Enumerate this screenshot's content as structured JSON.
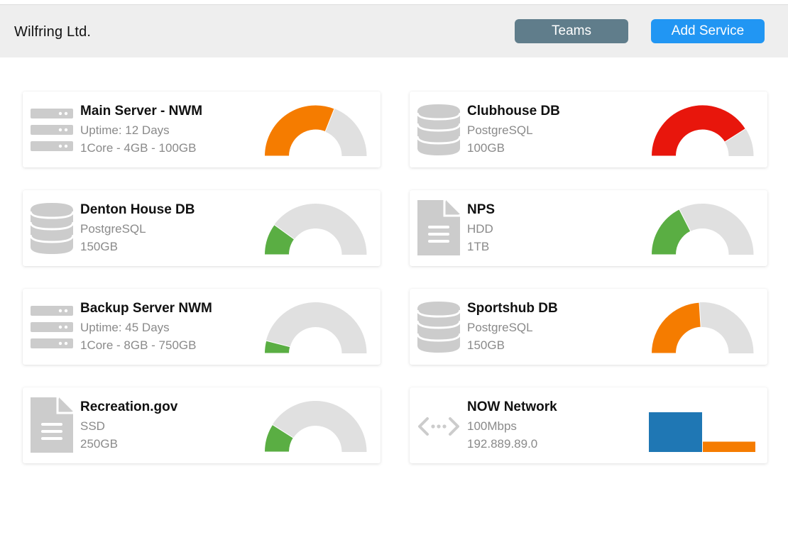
{
  "header": {
    "company": "Wilfring Ltd.",
    "teams_label": "Teams",
    "add_service_label": "Add Service"
  },
  "colors": {
    "orange": "#f57c00",
    "red": "#e8160c",
    "green": "#5aae43",
    "gray": "#e0e0e0",
    "blue": "#1f77b4",
    "icon": "#cccccc"
  },
  "cards": [
    {
      "name": "Main Server - NWM",
      "line1": "Uptime: 12 Days",
      "line2": "1Core - 4GB - 100GB",
      "icon": "server-icon",
      "gauge": 0.62,
      "color": "orange"
    },
    {
      "name": "Clubhouse DB",
      "line1": "PostgreSQL",
      "line2": "100GB",
      "icon": "database-icon",
      "gauge": 0.82,
      "color": "red"
    },
    {
      "name": "Denton House DB",
      "line1": "PostgreSQL",
      "line2": "150GB",
      "icon": "database-icon",
      "gauge": 0.2,
      "color": "green"
    },
    {
      "name": "NPS",
      "line1": "HDD",
      "line2": "1TB",
      "icon": "document-icon",
      "gauge": 0.35,
      "color": "green"
    },
    {
      "name": "Backup Server NWM",
      "line1": "Uptime: 45 Days",
      "line2": "1Core - 8GB - 750GB",
      "icon": "server-icon",
      "gauge": 0.08,
      "color": "green"
    },
    {
      "name": "Sportshub DB",
      "line1": "PostgreSQL",
      "line2": "150GB",
      "icon": "database-icon",
      "gauge": 0.48,
      "color": "orange"
    },
    {
      "name": "Recreation.gov",
      "line1": "SSD",
      "line2": "250GB",
      "icon": "document-icon",
      "gauge": 0.18,
      "color": "green"
    },
    {
      "name": "NOW Network",
      "line1": "100Mbps",
      "line2": "192.889.89.0",
      "icon": "network-icon",
      "bars": [
        {
          "value": 1.0,
          "color": "blue"
        },
        {
          "value": 0.26,
          "color": "orange"
        }
      ]
    }
  ]
}
